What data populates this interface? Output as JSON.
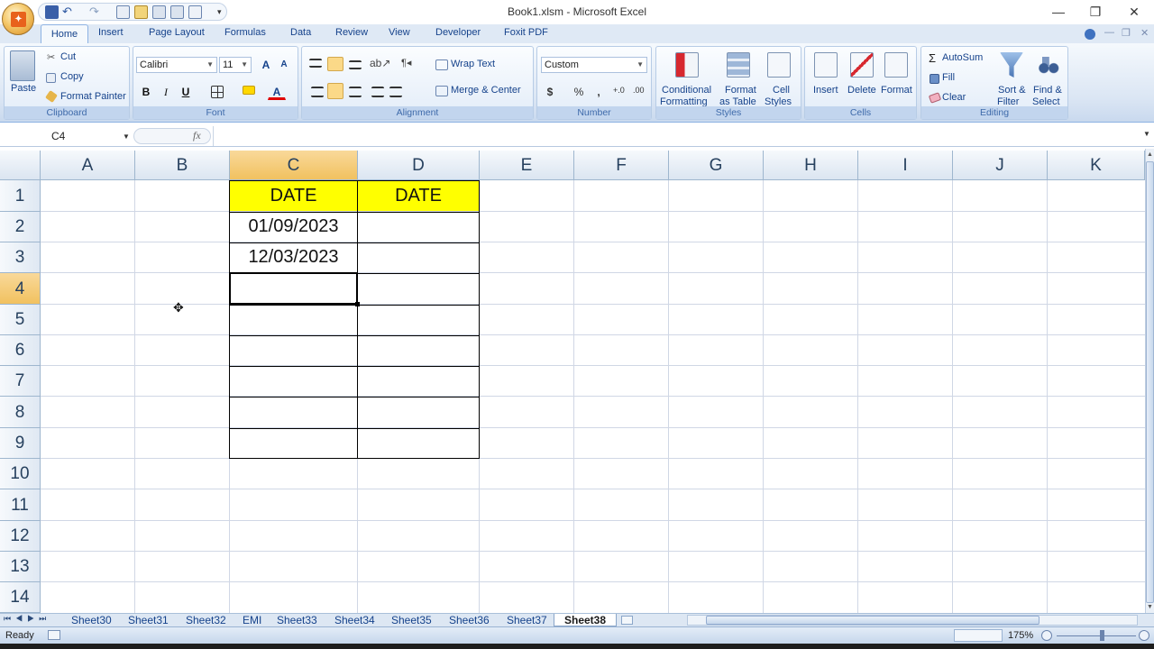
{
  "window": {
    "title": "Book1.xlsm - Microsoft Excel",
    "controls": {
      "minimize": "—",
      "restore": "❐",
      "close": "✕"
    }
  },
  "ribbon_tabs": [
    "Home",
    "Insert",
    "Page Layout",
    "Formulas",
    "Data",
    "Review",
    "View",
    "Developer",
    "Foxit PDF"
  ],
  "clipboard": {
    "paste": "Paste",
    "cut": "Cut",
    "copy": "Copy",
    "format_painter": "Format Painter",
    "label": "Clipboard"
  },
  "font": {
    "name": "Calibri",
    "size": "11",
    "bold": "B",
    "italic": "I",
    "underline": "U",
    "grow": "A",
    "shrink": "A",
    "color_btn": "A",
    "label": "Font"
  },
  "alignment": {
    "wrap": "Wrap Text",
    "merge": "Merge & Center",
    "label": "Alignment"
  },
  "number": {
    "format": "Custom",
    "currency": "$",
    "percent": "%",
    "comma": ",",
    "label": "Number"
  },
  "styles": {
    "conditional_1": "Conditional",
    "conditional_2": "Formatting",
    "format_table_1": "Format",
    "format_table_2": "as Table",
    "cell_styles_1": "Cell",
    "cell_styles_2": "Styles",
    "label": "Styles"
  },
  "cells": {
    "insert": "Insert",
    "delete": "Delete",
    "format": "Format",
    "label": "Cells"
  },
  "editing": {
    "autosum": "AutoSum",
    "fill": "Fill",
    "clear": "Clear",
    "sort_1": "Sort &",
    "sort_2": "Filter",
    "find_1": "Find &",
    "find_2": "Select",
    "label": "Editing",
    "sigma": "Σ"
  },
  "formula_bar": {
    "name_box": "C4",
    "fx": "fx",
    "value": ""
  },
  "columns": [
    "A",
    "B",
    "C",
    "D",
    "E",
    "F",
    "G",
    "H",
    "I",
    "J",
    "K"
  ],
  "rows": [
    "1",
    "2",
    "3",
    "4",
    "5",
    "6",
    "7",
    "8",
    "9",
    "10",
    "11",
    "12",
    "13",
    "14"
  ],
  "cells_data": {
    "C1": "DATE",
    "D1": "DATE",
    "C2": "01/09/2023",
    "C3": "12/03/2023"
  },
  "active_cell": "C4",
  "header_fill": "#ffff00",
  "sheets": [
    "Sheet30",
    "Sheet31",
    "Sheet32",
    "EMI",
    "Sheet33",
    "Sheet34",
    "Sheet35",
    "Sheet36",
    "Sheet37",
    "Sheet38"
  ],
  "active_sheet": "Sheet38",
  "status": {
    "ready": "Ready",
    "zoom": "175%"
  }
}
